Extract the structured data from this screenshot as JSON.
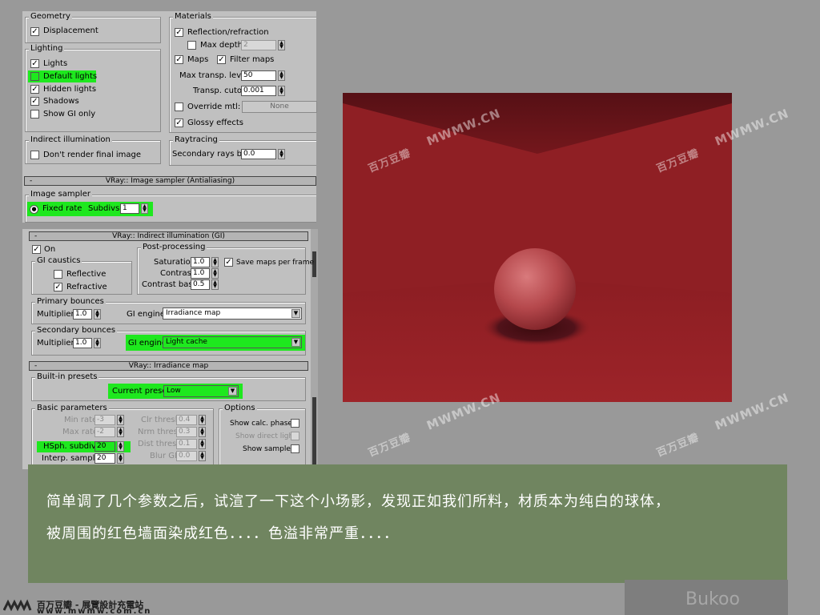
{
  "top_panel": {
    "geometry": {
      "title": "Geometry",
      "displacement": "Displacement"
    },
    "lighting": {
      "title": "Lighting",
      "items": [
        "Lights",
        "Default lights",
        "Hidden lights",
        "Shadows",
        "Show GI only"
      ]
    },
    "indirect": {
      "title": "Indirect illumination",
      "dont_render": "Don't render final image"
    },
    "materials": {
      "title": "Materials",
      "reflection": "Reflection/refraction",
      "max_depth_label": "Max depth",
      "max_depth_value": "2",
      "maps": "Maps",
      "filter_maps": "Filter maps",
      "max_transp_label": "Max transp. levels",
      "max_transp_value": "50",
      "transp_cutoff_label": "Transp. cutoff",
      "transp_cutoff_value": "0.001",
      "override_mtl": "Override mtl:",
      "override_button": "None",
      "glossy": "Glossy effects"
    },
    "raytracing": {
      "title": "Raytracing",
      "bias_label": "Secondary rays bias",
      "bias_value": "0.0"
    },
    "image_sampler_rollout": "VRay:: Image sampler (Antialiasing)",
    "image_sampler": {
      "title": "Image sampler",
      "fixed_rate": "Fixed rate",
      "subdivs_label": "Subdivs:",
      "subdivs_value": "1"
    }
  },
  "bottom_panel": {
    "gi_rollout": "VRay:: Indirect illumination (GI)",
    "on": "On",
    "gi_caustics": {
      "title": "GI caustics",
      "reflective": "Reflective",
      "refractive": "Refractive"
    },
    "post": {
      "title": "Post-processing",
      "saturation_label": "Saturation:",
      "saturation_value": "1.0",
      "save_maps": "Save maps per frame",
      "contrast_label": "Contrast:",
      "contrast_value": "1.0",
      "contrast_base_label": "Contrast base:",
      "contrast_base_value": "0.5"
    },
    "primary": {
      "title": "Primary bounces",
      "multiplier_label": "Multiplier:",
      "multiplier_value": "1.0",
      "engine_label": "GI engine:",
      "engine_value": "Irradiance map"
    },
    "secondary": {
      "title": "Secondary bounces",
      "multiplier_label": "Multiplier:",
      "multiplier_value": "1.0",
      "engine_label": "GI engine:",
      "engine_value": "Light cache"
    },
    "irradiance_rollout": "VRay:: Irradiance map",
    "presets": {
      "title": "Built-in presets",
      "current_label": "Current preset:",
      "current_value": "Low"
    },
    "basic": {
      "title": "Basic parameters",
      "min_rate_label": "Min rate:",
      "min_rate_value": "-3",
      "max_rate_label": "Max rate:",
      "max_rate_value": "-2",
      "hsph_label": "HSph. subdivs:",
      "hsph_value": "20",
      "interp_label": "Interp. samples:",
      "interp_value": "20",
      "clr_label": "Clr thresh:",
      "clr_value": "0.4",
      "nrm_label": "Nrm thresh:",
      "nrm_value": "0.3",
      "dist_label": "Dist thresh:",
      "dist_value": "0.1",
      "blur_label": "Blur GI:",
      "blur_value": "0.0"
    },
    "options": {
      "title": "Options",
      "show_calc": "Show calc. phase",
      "show_direct": "Show direct light",
      "show_samples": "Show samples"
    }
  },
  "watermark": "MWMW.CN",
  "watermark_cn": "百万豆瓣",
  "caption": {
    "line1": "简单调了几个参数之后，试渲了一下这个小场影，发现正如我们所料，材质本为纯白的球体，",
    "line2": "被周围的红色墙面染成红色．．．．色溢非常严重．．．．"
  },
  "footer": {
    "brand": "百万豆瓣 - 展覽設計充電站",
    "url": "www.mwmw.com.cn"
  },
  "author": "Bukoo",
  "colors": {
    "highlight": "#1ee81e",
    "caption_bg": "#708560",
    "wall": "#8e1f23"
  }
}
